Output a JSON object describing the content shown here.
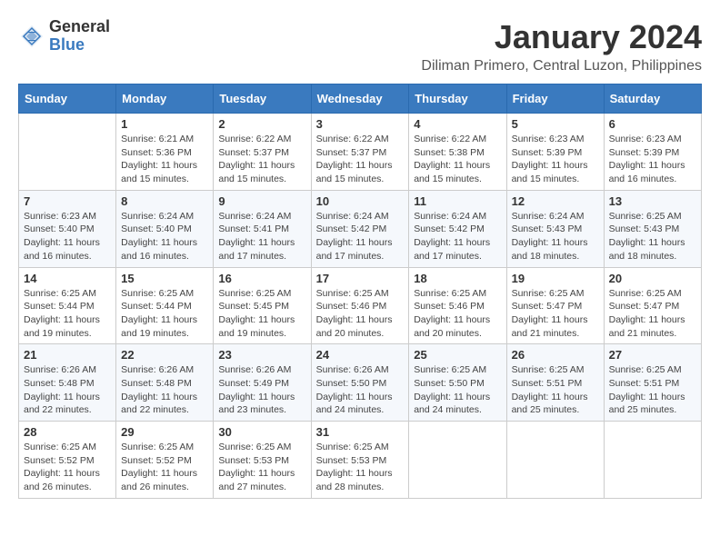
{
  "logo": {
    "line1": "General",
    "line2": "Blue"
  },
  "title": "January 2024",
  "subtitle": "Diliman Primero, Central Luzon, Philippines",
  "days_of_week": [
    "Sunday",
    "Monday",
    "Tuesday",
    "Wednesday",
    "Thursday",
    "Friday",
    "Saturday"
  ],
  "weeks": [
    [
      {
        "day": "",
        "info": ""
      },
      {
        "day": "1",
        "info": "Sunrise: 6:21 AM\nSunset: 5:36 PM\nDaylight: 11 hours and 15 minutes."
      },
      {
        "day": "2",
        "info": "Sunrise: 6:22 AM\nSunset: 5:37 PM\nDaylight: 11 hours and 15 minutes."
      },
      {
        "day": "3",
        "info": "Sunrise: 6:22 AM\nSunset: 5:37 PM\nDaylight: 11 hours and 15 minutes."
      },
      {
        "day": "4",
        "info": "Sunrise: 6:22 AM\nSunset: 5:38 PM\nDaylight: 11 hours and 15 minutes."
      },
      {
        "day": "5",
        "info": "Sunrise: 6:23 AM\nSunset: 5:39 PM\nDaylight: 11 hours and 15 minutes."
      },
      {
        "day": "6",
        "info": "Sunrise: 6:23 AM\nSunset: 5:39 PM\nDaylight: 11 hours and 16 minutes."
      }
    ],
    [
      {
        "day": "7",
        "info": "Sunrise: 6:23 AM\nSunset: 5:40 PM\nDaylight: 11 hours and 16 minutes."
      },
      {
        "day": "8",
        "info": "Sunrise: 6:24 AM\nSunset: 5:40 PM\nDaylight: 11 hours and 16 minutes."
      },
      {
        "day": "9",
        "info": "Sunrise: 6:24 AM\nSunset: 5:41 PM\nDaylight: 11 hours and 17 minutes."
      },
      {
        "day": "10",
        "info": "Sunrise: 6:24 AM\nSunset: 5:42 PM\nDaylight: 11 hours and 17 minutes."
      },
      {
        "day": "11",
        "info": "Sunrise: 6:24 AM\nSunset: 5:42 PM\nDaylight: 11 hours and 17 minutes."
      },
      {
        "day": "12",
        "info": "Sunrise: 6:24 AM\nSunset: 5:43 PM\nDaylight: 11 hours and 18 minutes."
      },
      {
        "day": "13",
        "info": "Sunrise: 6:25 AM\nSunset: 5:43 PM\nDaylight: 11 hours and 18 minutes."
      }
    ],
    [
      {
        "day": "14",
        "info": "Sunrise: 6:25 AM\nSunset: 5:44 PM\nDaylight: 11 hours and 19 minutes."
      },
      {
        "day": "15",
        "info": "Sunrise: 6:25 AM\nSunset: 5:44 PM\nDaylight: 11 hours and 19 minutes."
      },
      {
        "day": "16",
        "info": "Sunrise: 6:25 AM\nSunset: 5:45 PM\nDaylight: 11 hours and 19 minutes."
      },
      {
        "day": "17",
        "info": "Sunrise: 6:25 AM\nSunset: 5:46 PM\nDaylight: 11 hours and 20 minutes."
      },
      {
        "day": "18",
        "info": "Sunrise: 6:25 AM\nSunset: 5:46 PM\nDaylight: 11 hours and 20 minutes."
      },
      {
        "day": "19",
        "info": "Sunrise: 6:25 AM\nSunset: 5:47 PM\nDaylight: 11 hours and 21 minutes."
      },
      {
        "day": "20",
        "info": "Sunrise: 6:25 AM\nSunset: 5:47 PM\nDaylight: 11 hours and 21 minutes."
      }
    ],
    [
      {
        "day": "21",
        "info": "Sunrise: 6:26 AM\nSunset: 5:48 PM\nDaylight: 11 hours and 22 minutes."
      },
      {
        "day": "22",
        "info": "Sunrise: 6:26 AM\nSunset: 5:48 PM\nDaylight: 11 hours and 22 minutes."
      },
      {
        "day": "23",
        "info": "Sunrise: 6:26 AM\nSunset: 5:49 PM\nDaylight: 11 hours and 23 minutes."
      },
      {
        "day": "24",
        "info": "Sunrise: 6:26 AM\nSunset: 5:50 PM\nDaylight: 11 hours and 24 minutes."
      },
      {
        "day": "25",
        "info": "Sunrise: 6:25 AM\nSunset: 5:50 PM\nDaylight: 11 hours and 24 minutes."
      },
      {
        "day": "26",
        "info": "Sunrise: 6:25 AM\nSunset: 5:51 PM\nDaylight: 11 hours and 25 minutes."
      },
      {
        "day": "27",
        "info": "Sunrise: 6:25 AM\nSunset: 5:51 PM\nDaylight: 11 hours and 25 minutes."
      }
    ],
    [
      {
        "day": "28",
        "info": "Sunrise: 6:25 AM\nSunset: 5:52 PM\nDaylight: 11 hours and 26 minutes."
      },
      {
        "day": "29",
        "info": "Sunrise: 6:25 AM\nSunset: 5:52 PM\nDaylight: 11 hours and 26 minutes."
      },
      {
        "day": "30",
        "info": "Sunrise: 6:25 AM\nSunset: 5:53 PM\nDaylight: 11 hours and 27 minutes."
      },
      {
        "day": "31",
        "info": "Sunrise: 6:25 AM\nSunset: 5:53 PM\nDaylight: 11 hours and 28 minutes."
      },
      {
        "day": "",
        "info": ""
      },
      {
        "day": "",
        "info": ""
      },
      {
        "day": "",
        "info": ""
      }
    ]
  ]
}
